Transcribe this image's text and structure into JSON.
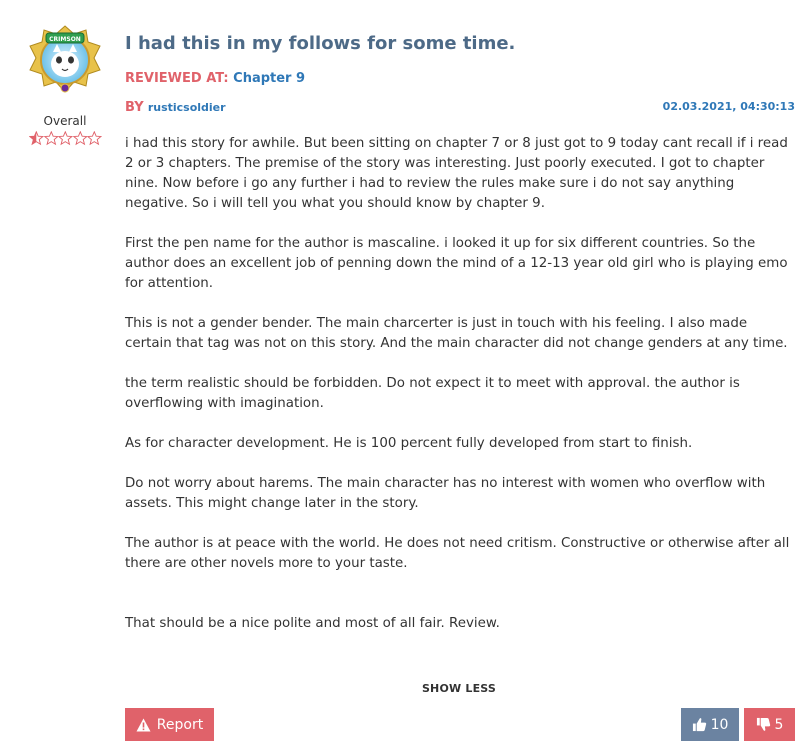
{
  "review": {
    "title": "I had this in my follows for some time.",
    "reviewed_at_label": "REVIEWED AT:",
    "reviewed_at_value": "Chapter 9",
    "by_label": "BY",
    "author": "rusticsoldier",
    "date": "02.03.2021, 04:30:13",
    "overall_label": "Overall",
    "rating": {
      "value": 0.5,
      "max": 5
    },
    "avatar_badge_text": "CRIMSON",
    "paragraphs": [
      "i had this story for awhile. But been sitting on chapter 7 or 8 just got to 9 today cant recall if i read 2 or 3 chapters. The premise of the story was interesting. Just poorly executed. I got to chapter nine.  Now before i go any further i had to review the rules make sure i do not say anything negative. So i will tell you what you should know by chapter 9.",
      "First the pen name for the author is mascaline. i looked it up for six different countries.  So the author does an excellent job of penning down the mind of a 12-13 year old girl who is playing emo for attention.",
      "This is not a gender bender. The main charcerter is just in touch with his feeling. I also made certain that tag was not on this story. And the main character did not change genders at any time.",
      "the term realistic should be forbidden. Do not expect it to meet with approval. the author is overflowing with imagination.",
      "As for character development. He is 100 percent fully developed from start to finish.",
      "Do not worry about harems. The main character has no interest with women who overflow with assets.  This might change later in the story.",
      "The author is at peace with the world. He does not need critism. Constructive or otherwise after all there are other novels more to your taste.",
      "That should be a nice polite and most of all fair. Review."
    ],
    "show_less_label": "SHOW LESS",
    "report_label": "Report",
    "upvotes": "10",
    "downvotes": "5"
  },
  "colors": {
    "accent_red": "#e0626a",
    "link_blue": "#2f78b7",
    "title_blue": "#4d6a87",
    "vote_blue": "#6b83a1"
  }
}
